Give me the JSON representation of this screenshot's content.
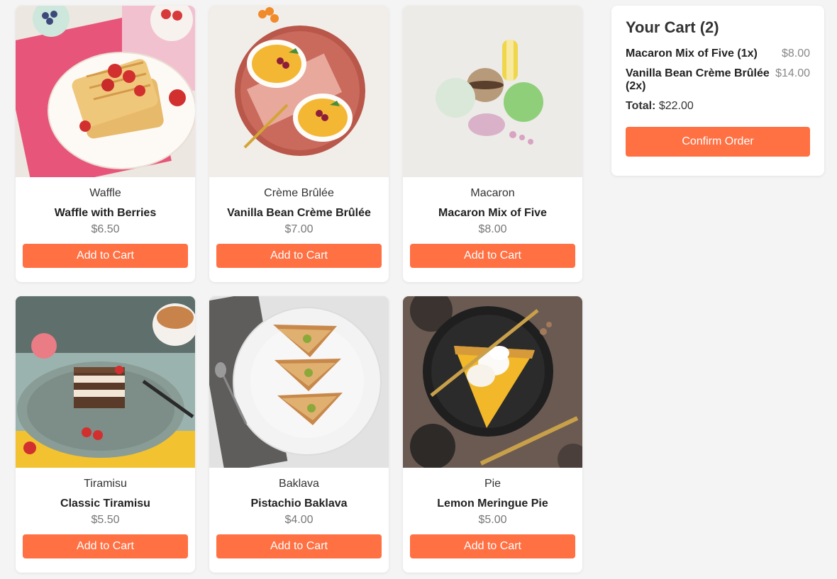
{
  "products": [
    {
      "category": "Waffle",
      "name": "Waffle with Berries",
      "price": "$6.50",
      "button": "Add to Cart",
      "image": "waffle-photo"
    },
    {
      "category": "Crème Brûlée",
      "name": "Vanilla Bean Crème Brûlée",
      "price": "$7.00",
      "button": "Add to Cart",
      "image": "creme-brulee-photo"
    },
    {
      "category": "Macaron",
      "name": "Macaron Mix of Five",
      "price": "$8.00",
      "button": "Add to Cart",
      "image": "macaron-photo"
    },
    {
      "category": "Tiramisu",
      "name": "Classic Tiramisu",
      "price": "$5.50",
      "button": "Add to Cart",
      "image": "tiramisu-photo"
    },
    {
      "category": "Baklava",
      "name": "Pistachio Baklava",
      "price": "$4.00",
      "button": "Add to Cart",
      "image": "baklava-photo"
    },
    {
      "category": "Pie",
      "name": "Lemon Meringue Pie",
      "price": "$5.00",
      "button": "Add to Cart",
      "image": "lemon-pie-photo"
    }
  ],
  "cart": {
    "title": "Your Cart (2)",
    "items": [
      {
        "name": "Macaron Mix of Five (1x)",
        "price": "$8.00"
      },
      {
        "name": "Vanilla Bean Crème Brûlée (2x)",
        "price": "$14.00"
      }
    ],
    "total_label": "Total:",
    "total_value": "$22.00",
    "confirm_label": "Confirm Order"
  },
  "colors": {
    "accent": "#ff7043",
    "background": "#f4f4f4"
  }
}
